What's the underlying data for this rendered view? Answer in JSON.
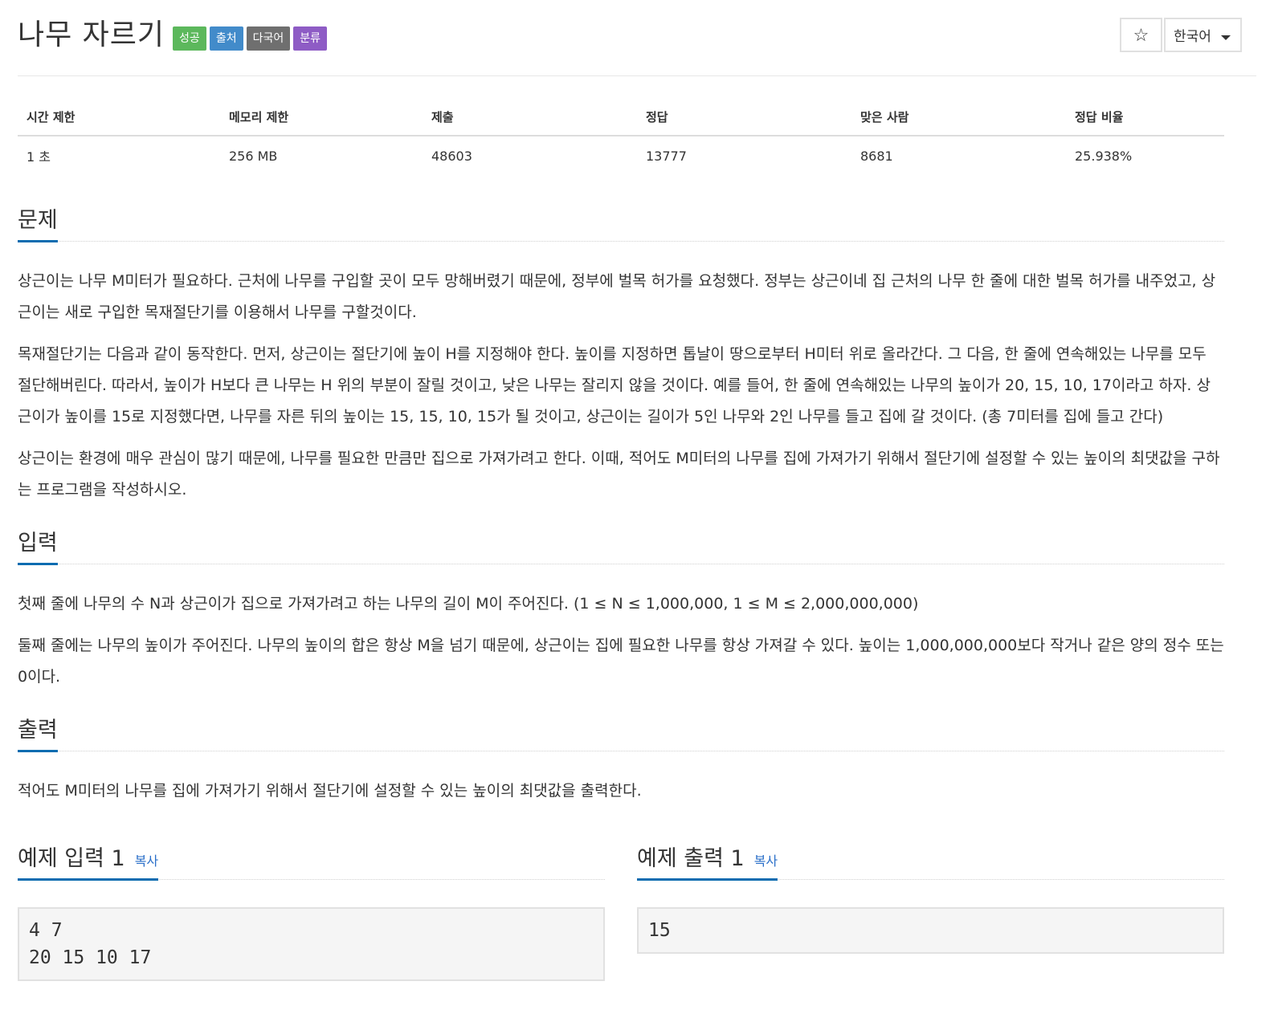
{
  "problem": {
    "title": "나무 자르기",
    "labels": [
      "성공",
      "출처",
      "다국어",
      "분류"
    ]
  },
  "toolbar": {
    "star_icon": "☆",
    "language": "한국어"
  },
  "info": {
    "headers": [
      "시간 제한",
      "메모리 제한",
      "제출",
      "정답",
      "맞은 사람",
      "정답 비율"
    ],
    "values": [
      "1 초",
      "256 MB",
      "48603",
      "13777",
      "8681",
      "25.938%"
    ]
  },
  "sections": {
    "description": {
      "title": "문제",
      "paragraphs": [
        "상근이는 나무 M미터가 필요하다. 근처에 나무를 구입할 곳이 모두 망해버렸기 때문에, 정부에 벌목 허가를 요청했다. 정부는 상근이네 집 근처의 나무 한 줄에 대한 벌목 허가를 내주었고, 상근이는 새로 구입한 목재절단기를 이용해서 나무를 구할것이다.",
        "목재절단기는 다음과 같이 동작한다. 먼저, 상근이는 절단기에 높이 H를 지정해야 한다. 높이를 지정하면 톱날이 땅으로부터 H미터 위로 올라간다. 그 다음, 한 줄에 연속해있는 나무를 모두 절단해버린다. 따라서, 높이가 H보다 큰 나무는 H 위의 부분이 잘릴 것이고, 낮은 나무는 잘리지 않을 것이다. 예를 들어, 한 줄에 연속해있는 나무의 높이가 20, 15, 10, 17이라고 하자. 상근이가 높이를 15로 지정했다면, 나무를 자른 뒤의 높이는 15, 15, 10, 15가 될 것이고, 상근이는 길이가 5인 나무와 2인 나무를 들고 집에 갈 것이다. (총 7미터를 집에 들고 간다)",
        "상근이는 환경에 매우 관심이 많기 때문에, 나무를 필요한 만큼만 집으로 가져가려고 한다. 이때, 적어도 M미터의 나무를 집에 가져가기 위해서 절단기에 설정할 수 있는 높이의 최댓값을 구하는 프로그램을 작성하시오."
      ]
    },
    "input": {
      "title": "입력",
      "paragraphs": [
        "첫째 줄에 나무의 수 N과 상근이가 집으로 가져가려고 하는 나무의 길이 M이 주어진다. (1 ≤ N ≤ 1,000,000, 1 ≤ M ≤ 2,000,000,000)",
        "둘째 줄에는 나무의 높이가 주어진다. 나무의 높이의 합은 항상 M을 넘기 때문에, 상근이는 집에 필요한 나무를 항상 가져갈 수 있다. 높이는 1,000,000,000보다 작거나 같은 양의 정수 또는 0이다."
      ]
    },
    "output": {
      "title": "출력",
      "paragraphs": [
        "적어도 M미터의 나무를 집에 가져가기 위해서 절단기에 설정할 수 있는 높이의 최댓값을 출력한다."
      ]
    }
  },
  "samples": {
    "input": {
      "title": "예제 입력 1",
      "copy": "복사",
      "content": "4 7\n20 15 10 17"
    },
    "output": {
      "title": "예제 출력 1",
      "copy": "복사",
      "content": "15"
    }
  },
  "colors": {
    "accent": "#0d6cb0",
    "label_success": "#5cb85c",
    "label_info": "#428bca",
    "label_default": "#6f6f6f",
    "label_purple": "#8e5cc5",
    "link": "#2a6fc9"
  }
}
